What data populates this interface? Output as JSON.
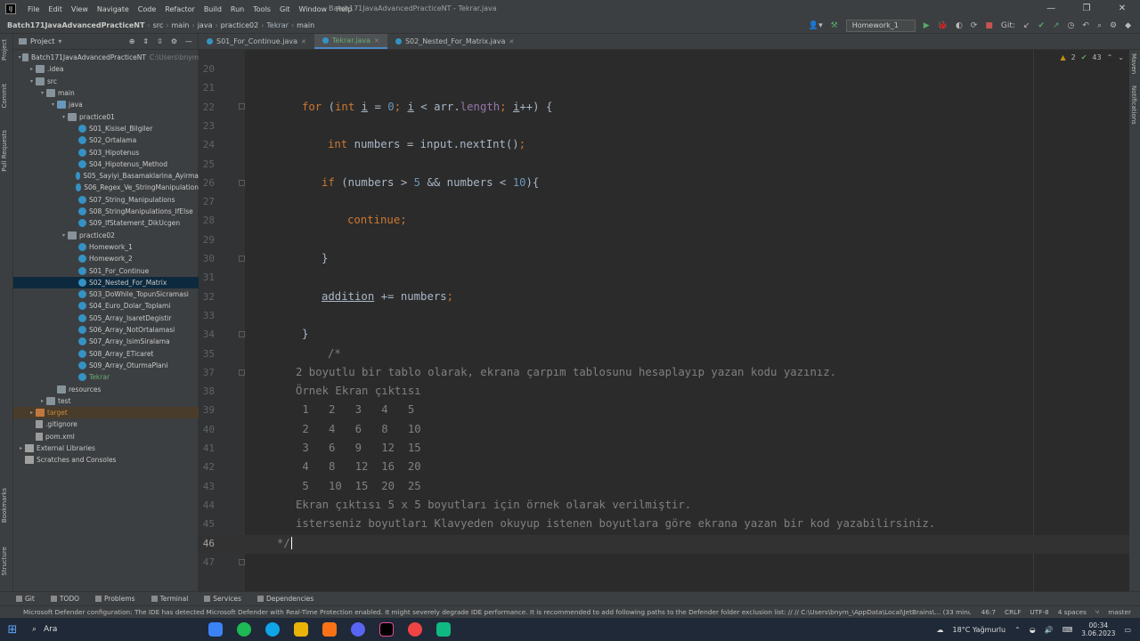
{
  "menu": {
    "items": [
      "File",
      "Edit",
      "View",
      "Navigate",
      "Code",
      "Refactor",
      "Build",
      "Run",
      "Tools",
      "Git",
      "Window",
      "Help"
    ],
    "window_title": "Batch171JavaAdvancedPracticeNT - Tekrar.java"
  },
  "breadcrumb": [
    "Batch171JavaAdvancedPracticeNT",
    "src",
    "main",
    "java",
    "practice02",
    "Tekrar",
    "main"
  ],
  "toolbar": {
    "run_config": "Homework_1",
    "git_label": "Git:"
  },
  "side_tabs": {
    "project": "Project",
    "commit": "Commit",
    "pull_requests": "Pull Requests",
    "bookmarks": "Bookmarks",
    "structure": "Structure"
  },
  "right_tabs": {
    "maven": "Maven",
    "notifications": "Notifications"
  },
  "project_panel": {
    "title": "Project",
    "tree": [
      {
        "label": "Batch171JavaAdvancedPracticeNT",
        "extra": "C:\\Users\\bnym",
        "depth": 0,
        "arrow": "▾",
        "icon": "folder"
      },
      {
        "label": ".idea",
        "depth": 1,
        "arrow": "▸",
        "icon": "folder"
      },
      {
        "label": "src",
        "depth": 1,
        "arrow": "▾",
        "icon": "folder"
      },
      {
        "label": "main",
        "depth": 2,
        "arrow": "▾",
        "icon": "folder"
      },
      {
        "label": "java",
        "depth": 3,
        "arrow": "▾",
        "icon": "folder-blue"
      },
      {
        "label": "practice01",
        "depth": 4,
        "arrow": "▾",
        "icon": "folder"
      },
      {
        "label": "S01_Kisisel_Bilgiler",
        "depth": 5,
        "icon": "class"
      },
      {
        "label": "S02_Ortalama",
        "depth": 5,
        "icon": "class"
      },
      {
        "label": "S03_Hipotenus",
        "depth": 5,
        "icon": "class"
      },
      {
        "label": "S04_Hipotenus_Method",
        "depth": 5,
        "icon": "class"
      },
      {
        "label": "S05_Sayiyi_Basamaklarina_Ayirma",
        "depth": 5,
        "icon": "class"
      },
      {
        "label": "S06_Regex_Ve_StringManipulation",
        "depth": 5,
        "icon": "class"
      },
      {
        "label": "S07_String_Manipulations",
        "depth": 5,
        "icon": "class"
      },
      {
        "label": "S08_StringManipulations_IfElse",
        "depth": 5,
        "icon": "class"
      },
      {
        "label": "S09_IfStatement_DikUcgen",
        "depth": 5,
        "icon": "class"
      },
      {
        "label": "practice02",
        "depth": 4,
        "arrow": "▾",
        "icon": "folder"
      },
      {
        "label": "Homework_1",
        "depth": 5,
        "icon": "class"
      },
      {
        "label": "Homework_2",
        "depth": 5,
        "icon": "class"
      },
      {
        "label": "S01_For_Continue",
        "depth": 5,
        "icon": "class"
      },
      {
        "label": "S02_Nested_For_Matrix",
        "depth": 5,
        "icon": "class",
        "selected": true
      },
      {
        "label": "S03_DoWhile_TopunSicramasi",
        "depth": 5,
        "icon": "class"
      },
      {
        "label": "S04_Euro_Dolar_Toplami",
        "depth": 5,
        "icon": "class"
      },
      {
        "label": "S05_Array_IsaretDegistir",
        "depth": 5,
        "icon": "class"
      },
      {
        "label": "S06_Array_NotOrtalamasi",
        "depth": 5,
        "icon": "class"
      },
      {
        "label": "S07_Array_IsimSiralama",
        "depth": 5,
        "icon": "class"
      },
      {
        "label": "S08_Array_ETicaret",
        "depth": 5,
        "icon": "class"
      },
      {
        "label": "S09_Array_OturmaPlani",
        "depth": 5,
        "icon": "class"
      },
      {
        "label": "Tekrar",
        "depth": 5,
        "icon": "class",
        "style": "green"
      },
      {
        "label": "resources",
        "depth": 3,
        "icon": "folder"
      },
      {
        "label": "test",
        "depth": 2,
        "arrow": "▸",
        "icon": "folder"
      },
      {
        "label": "target",
        "depth": 1,
        "arrow": "▸",
        "icon": "folder-orange",
        "style": "orange"
      },
      {
        "label": ".gitignore",
        "depth": 1,
        "icon": "file"
      },
      {
        "label": "pom.xml",
        "depth": 1,
        "icon": "file"
      },
      {
        "label": "External Libraries",
        "depth": 0,
        "arrow": "▸",
        "icon": "lib"
      },
      {
        "label": "Scratches and Consoles",
        "depth": 0,
        "icon": "lib"
      }
    ]
  },
  "editor_tabs": [
    {
      "label": "S01_For_Continue.java",
      "active": false
    },
    {
      "label": "Tekrar.java",
      "active": true
    },
    {
      "label": "S02_Nested_For_Matrix.java",
      "active": false
    }
  ],
  "inspections": {
    "warnings": "2",
    "weak": "43"
  },
  "code_lines": [
    {
      "n": "20",
      "indent": 0,
      "tokens": []
    },
    {
      "n": "21",
      "indent": 0,
      "tokens": []
    },
    {
      "n": "22",
      "indent": 64,
      "tokens": [
        {
          "t": "for",
          "c": "kw"
        },
        {
          "t": " (",
          "c": ""
        },
        {
          "t": "int",
          "c": "kw"
        },
        {
          "t": " ",
          "c": ""
        },
        {
          "t": "i",
          "c": "ul"
        },
        {
          "t": " = ",
          "c": ""
        },
        {
          "t": "0",
          "c": "num"
        },
        {
          "t": "; ",
          "c": "kw"
        },
        {
          "t": "i",
          "c": "ul"
        },
        {
          "t": " < arr.",
          "c": ""
        },
        {
          "t": "length",
          "c": "fld"
        },
        {
          "t": "; ",
          "c": "kw"
        },
        {
          "t": "i",
          "c": "ul"
        },
        {
          "t": "++) {",
          "c": ""
        }
      ]
    },
    {
      "n": "23",
      "indent": 0,
      "tokens": []
    },
    {
      "n": "24",
      "indent": 93,
      "tokens": [
        {
          "t": "int",
          "c": "kw"
        },
        {
          "t": " numbers = input.nextInt()",
          "c": ""
        },
        {
          "t": ";",
          "c": "kw"
        }
      ]
    },
    {
      "n": "25",
      "indent": 0,
      "tokens": []
    },
    {
      "n": "26",
      "indent": 86,
      "tokens": [
        {
          "t": "if",
          "c": "kw"
        },
        {
          "t": " (numbers > ",
          "c": ""
        },
        {
          "t": "5",
          "c": "num"
        },
        {
          "t": " && numbers < ",
          "c": ""
        },
        {
          "t": "10",
          "c": "num"
        },
        {
          "t": "){",
          "c": ""
        }
      ]
    },
    {
      "n": "27",
      "indent": 0,
      "tokens": []
    },
    {
      "n": "28",
      "indent": 115,
      "tokens": [
        {
          "t": "continue;",
          "c": "kw"
        }
      ]
    },
    {
      "n": "29",
      "indent": 0,
      "tokens": []
    },
    {
      "n": "30",
      "indent": 86,
      "tokens": [
        {
          "t": "}",
          "c": ""
        }
      ]
    },
    {
      "n": "31",
      "indent": 0,
      "tokens": []
    },
    {
      "n": "32",
      "indent": 86,
      "tokens": [
        {
          "t": "addition",
          "c": "ul"
        },
        {
          "t": " += numbers",
          "c": ""
        },
        {
          "t": ";",
          "c": "kw"
        }
      ]
    },
    {
      "n": "33",
      "indent": 0,
      "tokens": []
    },
    {
      "n": "34",
      "indent": 64,
      "tokens": [
        {
          "t": "}",
          "c": ""
        }
      ]
    },
    {
      "n": "35",
      "indent": 93,
      "tokens": [
        {
          "t": "/*",
          "c": "cm"
        }
      ]
    },
    {
      "n": "37",
      "indent": 57,
      "tokens": [
        {
          "t": "2 boyutlu bir tablo olarak, ekrana çarpım tablosunu hesaplayıp yazan kodu yazınız.",
          "c": "cm"
        }
      ]
    },
    {
      "n": "38",
      "indent": 57,
      "tokens": [
        {
          "t": "Örnek Ekran çıktısı",
          "c": "cm"
        }
      ]
    },
    {
      "n": "39",
      "indent": 57,
      "tokens": [
        {
          "t": " 1   2   3   4   5",
          "c": "cm"
        }
      ]
    },
    {
      "n": "40",
      "indent": 57,
      "tokens": [
        {
          "t": " 2   4   6   8   10",
          "c": "cm"
        }
      ]
    },
    {
      "n": "41",
      "indent": 57,
      "tokens": [
        {
          "t": " 3   6   9   12  15",
          "c": "cm"
        }
      ]
    },
    {
      "n": "42",
      "indent": 57,
      "tokens": [
        {
          "t": " 4   8   12  16  20",
          "c": "cm"
        }
      ]
    },
    {
      "n": "43",
      "indent": 57,
      "tokens": [
        {
          "t": " 5   10  15  20  25",
          "c": "cm"
        }
      ]
    },
    {
      "n": "44",
      "indent": 57,
      "tokens": [
        {
          "t": "Ekran çıktısı 5 x 5 boyutları için örnek olarak verilmiştir.",
          "c": "cm"
        }
      ]
    },
    {
      "n": "45",
      "indent": 57,
      "tokens": [
        {
          "t": "isterseniz boyutları Klavyeden okuyup istenen boyutlara göre ekrana yazan bir kod yazabilirsiniz.",
          "c": "cm"
        }
      ]
    },
    {
      "n": "46",
      "indent": 36,
      "tokens": [
        {
          "t": "*/",
          "c": "cm"
        }
      ],
      "current": true
    },
    {
      "n": "47",
      "indent": 0,
      "tokens": []
    }
  ],
  "bottom_tabs": [
    "Git",
    "TODO",
    "Problems",
    "Terminal",
    "Services",
    "Dependencies"
  ],
  "status": {
    "message": "Microsoft Defender configuration: The IDE has detected Microsoft Defender with Real-Time Protection enabled. It might severely degrade IDE performance. It is recommended to add following paths to the Defender folder exclusion list: // // C:\\Users\\bnym_\\AppData\\Local\\JetBrains\\... (33 minutes ago)",
    "position": "46:7",
    "line_sep": "CRLF",
    "encoding": "UTF-8",
    "indent": "4 spaces",
    "branch": "master"
  },
  "taskbar": {
    "search": "Ara",
    "weather": "18°C Yağmurlu",
    "time": "00:34",
    "date": "3.06.2023"
  },
  "colors": {
    "keyword": "#cc7832",
    "number": "#6897bb",
    "field": "#9876aa",
    "comment": "#808080",
    "selection": "#0d293e"
  }
}
